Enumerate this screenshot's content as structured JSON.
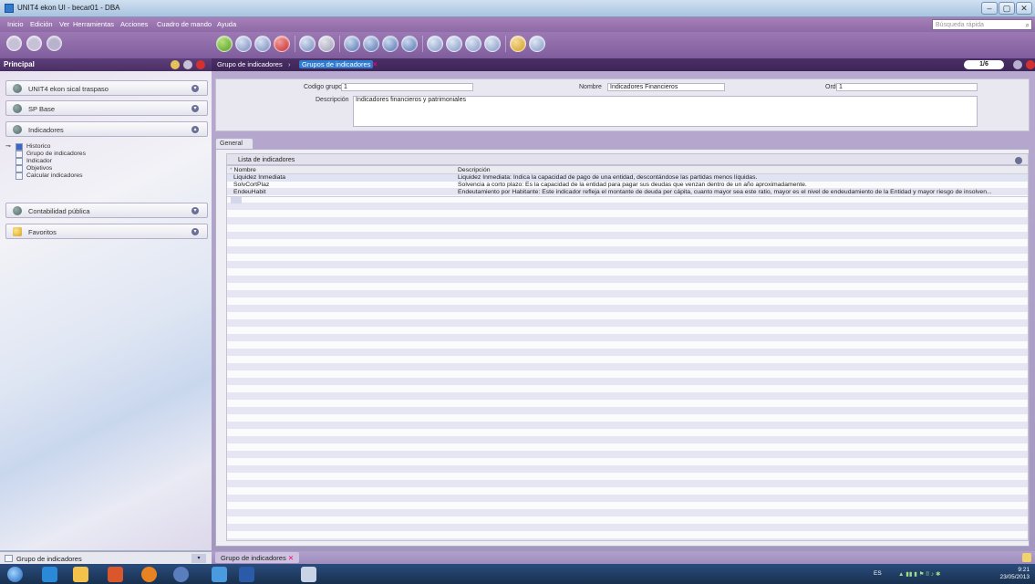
{
  "window": {
    "title": "UNIT4 ekon UI - becar01 - DBA",
    "minimize": "‒",
    "maximize": "▢",
    "close": "✕"
  },
  "menu": {
    "items": [
      "Inicio",
      "Edición",
      "Ver",
      "Herramientas",
      "Acciones",
      "Cuadro de mando",
      "Ayuda"
    ],
    "search_placeholder": "Búsqueda rápida"
  },
  "left_panel": {
    "header": "Principal",
    "sections": [
      {
        "label": "UNIT4 ekon sical traspaso"
      },
      {
        "label": "SP Base"
      },
      {
        "label": "Indicadores"
      },
      {
        "label": "Contabilidad pública"
      },
      {
        "label": "Favoritos"
      }
    ],
    "tree": {
      "root": "Historico",
      "children": [
        "Grupo de indicadores",
        "Indicador",
        "Objetivos",
        "Calcular indicadores"
      ]
    },
    "bottom": {
      "label": "Grupo de indicadores"
    }
  },
  "breadcrumb": [
    "Grupo de indicadores",
    "Grupos de indicadores"
  ],
  "page_indicator": "1/6",
  "form": {
    "codigo_label": "Codigo grupo",
    "codigo_value": "1",
    "nombre_label": "Nombre",
    "nombre_value": "Indicadores Financieros",
    "orden_label": "Orden",
    "orden_value": "1",
    "descripcion_label": "Descripción",
    "descripcion_value": "Indicadores financieros y patrimoniales"
  },
  "tab_general": "General",
  "list": {
    "title": "Lista de indicadores",
    "columns": [
      "Nombre",
      "Descripción"
    ],
    "rows": [
      {
        "nombre": "Liquidez Inmediata",
        "descripcion": "Liquidez Inmediata: Indica la capacidad de pago de una entidad, descontándose las partidas menos líquidas."
      },
      {
        "nombre": "SolvCortPlaz",
        "descripcion": "Solvencia a corto plazo: Es la capacidad de la entidad para pagar sus deudas que venzan dentro de un año aproximadamente."
      },
      {
        "nombre": "EndeuHabit",
        "descripcion": "Endeutamiento por Habitante: Este indicador refleja el montante de deuda per cápita, cuanto mayor sea este ratio, mayor es el nivel de endeudamiento de la Entidad y mayor riesgo de insolven..."
      }
    ]
  },
  "bottom_tab": "Grupo de indicadores",
  "taskbar": {
    "lang": "ES",
    "time": "9:21",
    "date": "23/05/2013"
  },
  "colors": {
    "accent": "#7f5d9c",
    "header": "#4a2f63"
  }
}
